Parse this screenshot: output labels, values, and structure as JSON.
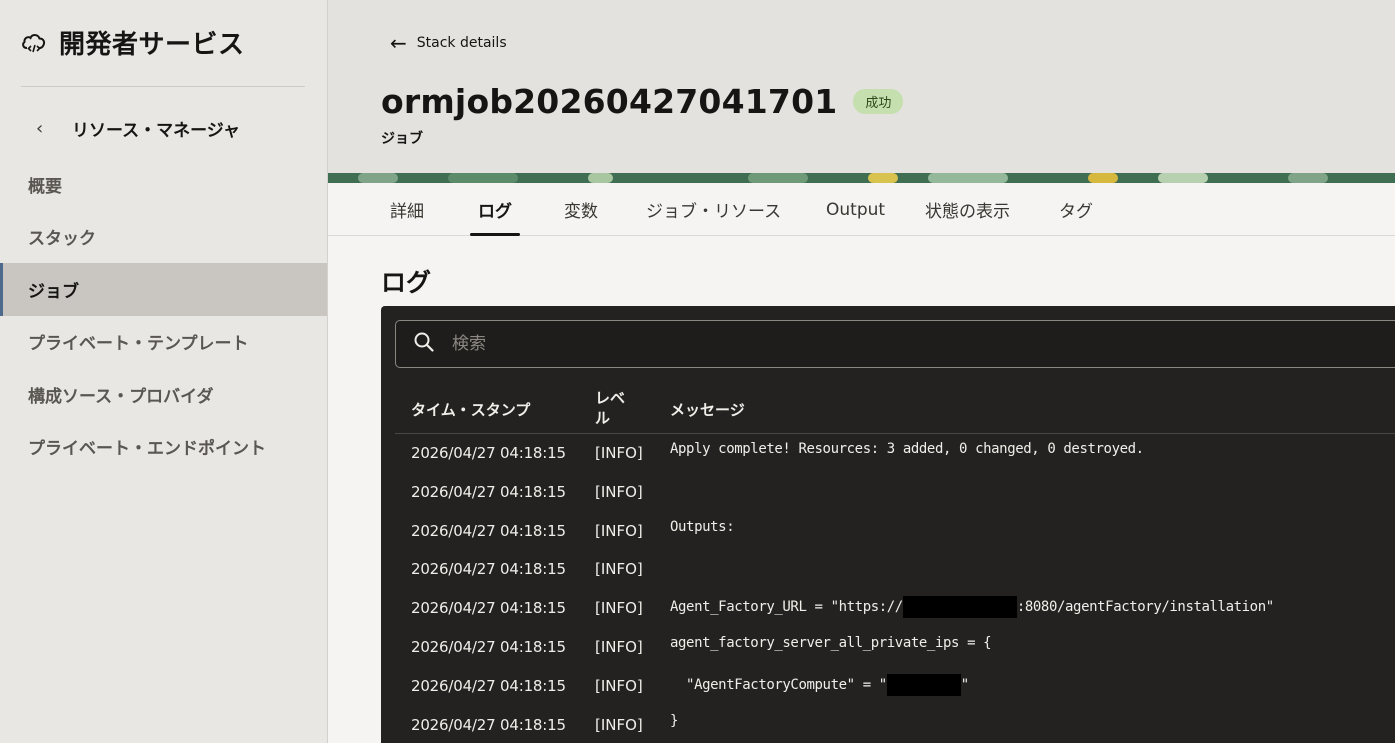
{
  "sidebar": {
    "brand_title": "開発者サービス",
    "brand_icon": "cloud-developer-icon",
    "back_label": "リソース・マネージャ",
    "items": [
      {
        "label": "概要",
        "active": false
      },
      {
        "label": "スタック",
        "active": false
      },
      {
        "label": "ジョブ",
        "active": true
      },
      {
        "label": "プライベート・テンプレート",
        "active": false
      },
      {
        "label": "構成ソース・プロバイダ",
        "active": false
      },
      {
        "label": "プライベート・エンドポイント",
        "active": false
      }
    ]
  },
  "header": {
    "back_link": "Stack details",
    "title": "ormjob20260427041701",
    "status_badge": "成功",
    "subtitle": "ジョブ"
  },
  "tabs": [
    {
      "label": "詳細",
      "active": false
    },
    {
      "label": "ログ",
      "active": true
    },
    {
      "label": "変数",
      "active": false
    },
    {
      "label": "ジョブ・リソース",
      "active": false
    },
    {
      "label": "Output",
      "active": false
    },
    {
      "label": "状態の表示",
      "active": false
    },
    {
      "label": "タグ",
      "active": false
    }
  ],
  "log": {
    "section_title": "ログ",
    "search_placeholder": "検索",
    "columns": {
      "timestamp": "タイム・スタンプ",
      "level": "レベ\nル",
      "message": "メッセージ"
    },
    "rows": [
      {
        "timestamp": "2026/04/27 04:18:15",
        "level": "[INFO]",
        "message": "Apply complete! Resources: 3 added, 0 changed, 0 destroyed."
      },
      {
        "timestamp": "2026/04/27 04:18:15",
        "level": "[INFO]",
        "message": ""
      },
      {
        "timestamp": "2026/04/27 04:18:15",
        "level": "[INFO]",
        "message": "Outputs:"
      },
      {
        "timestamp": "2026/04/27 04:18:15",
        "level": "[INFO]",
        "message": ""
      },
      {
        "timestamp": "2026/04/27 04:18:15",
        "level": "[INFO]",
        "message_pre": "Agent_Factory_URL = \"https://",
        "message_post": ":8080/agentFactory/installation\"",
        "redacted": true
      },
      {
        "timestamp": "2026/04/27 04:18:15",
        "level": "[INFO]",
        "message": "agent_factory_server_all_private_ips = {"
      },
      {
        "timestamp": "2026/04/27 04:18:15",
        "level": "[INFO]",
        "message_pre": "  \"AgentFactoryCompute\" = \"",
        "message_post": "\"",
        "redacted": true
      },
      {
        "timestamp": "2026/04/27 04:18:15",
        "level": "[INFO]",
        "message": "}"
      }
    ]
  },
  "colors": {
    "sidebar_bg": "#e9e7e4",
    "header_bg": "#e4e2df",
    "log_bg": "#242220",
    "badge_bg": "#c6dfae",
    "active_nav_bg": "#c9c6c1"
  }
}
